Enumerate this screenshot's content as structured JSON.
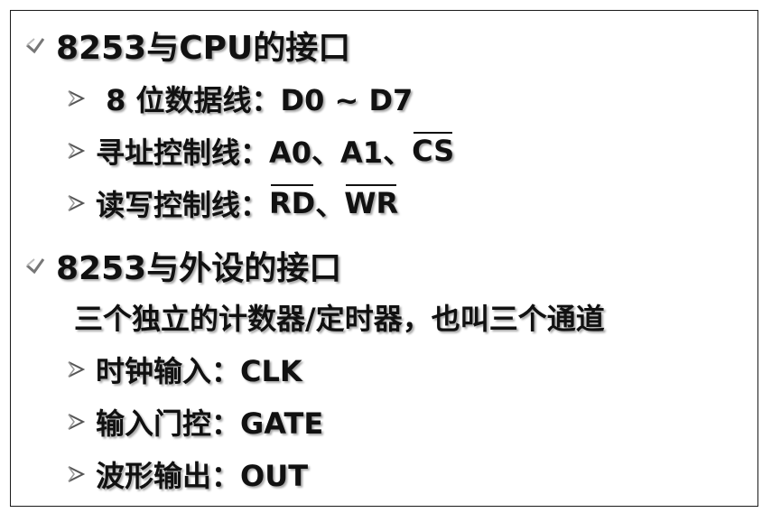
{
  "slide": {
    "sections": [
      {
        "heading": "8253与CPU的接口",
        "items": [
          {
            "label": " 8 位数据线：D0 ~ D7"
          },
          {
            "label": "寻址控制线：A0、A1、",
            "overline": "CS"
          },
          {
            "label_prefix": "读写控制线：",
            "ov1": "RD",
            "sep": "、",
            "ov2": "WR"
          }
        ]
      },
      {
        "heading": "8253与外设的接口",
        "note": "三个独立的计数器/定时器，也叫三个通道",
        "items": [
          {
            "label": "时钟输入：CLK"
          },
          {
            "label": "输入门控：GATE"
          },
          {
            "label": "波形输出：OUT"
          }
        ]
      }
    ]
  }
}
